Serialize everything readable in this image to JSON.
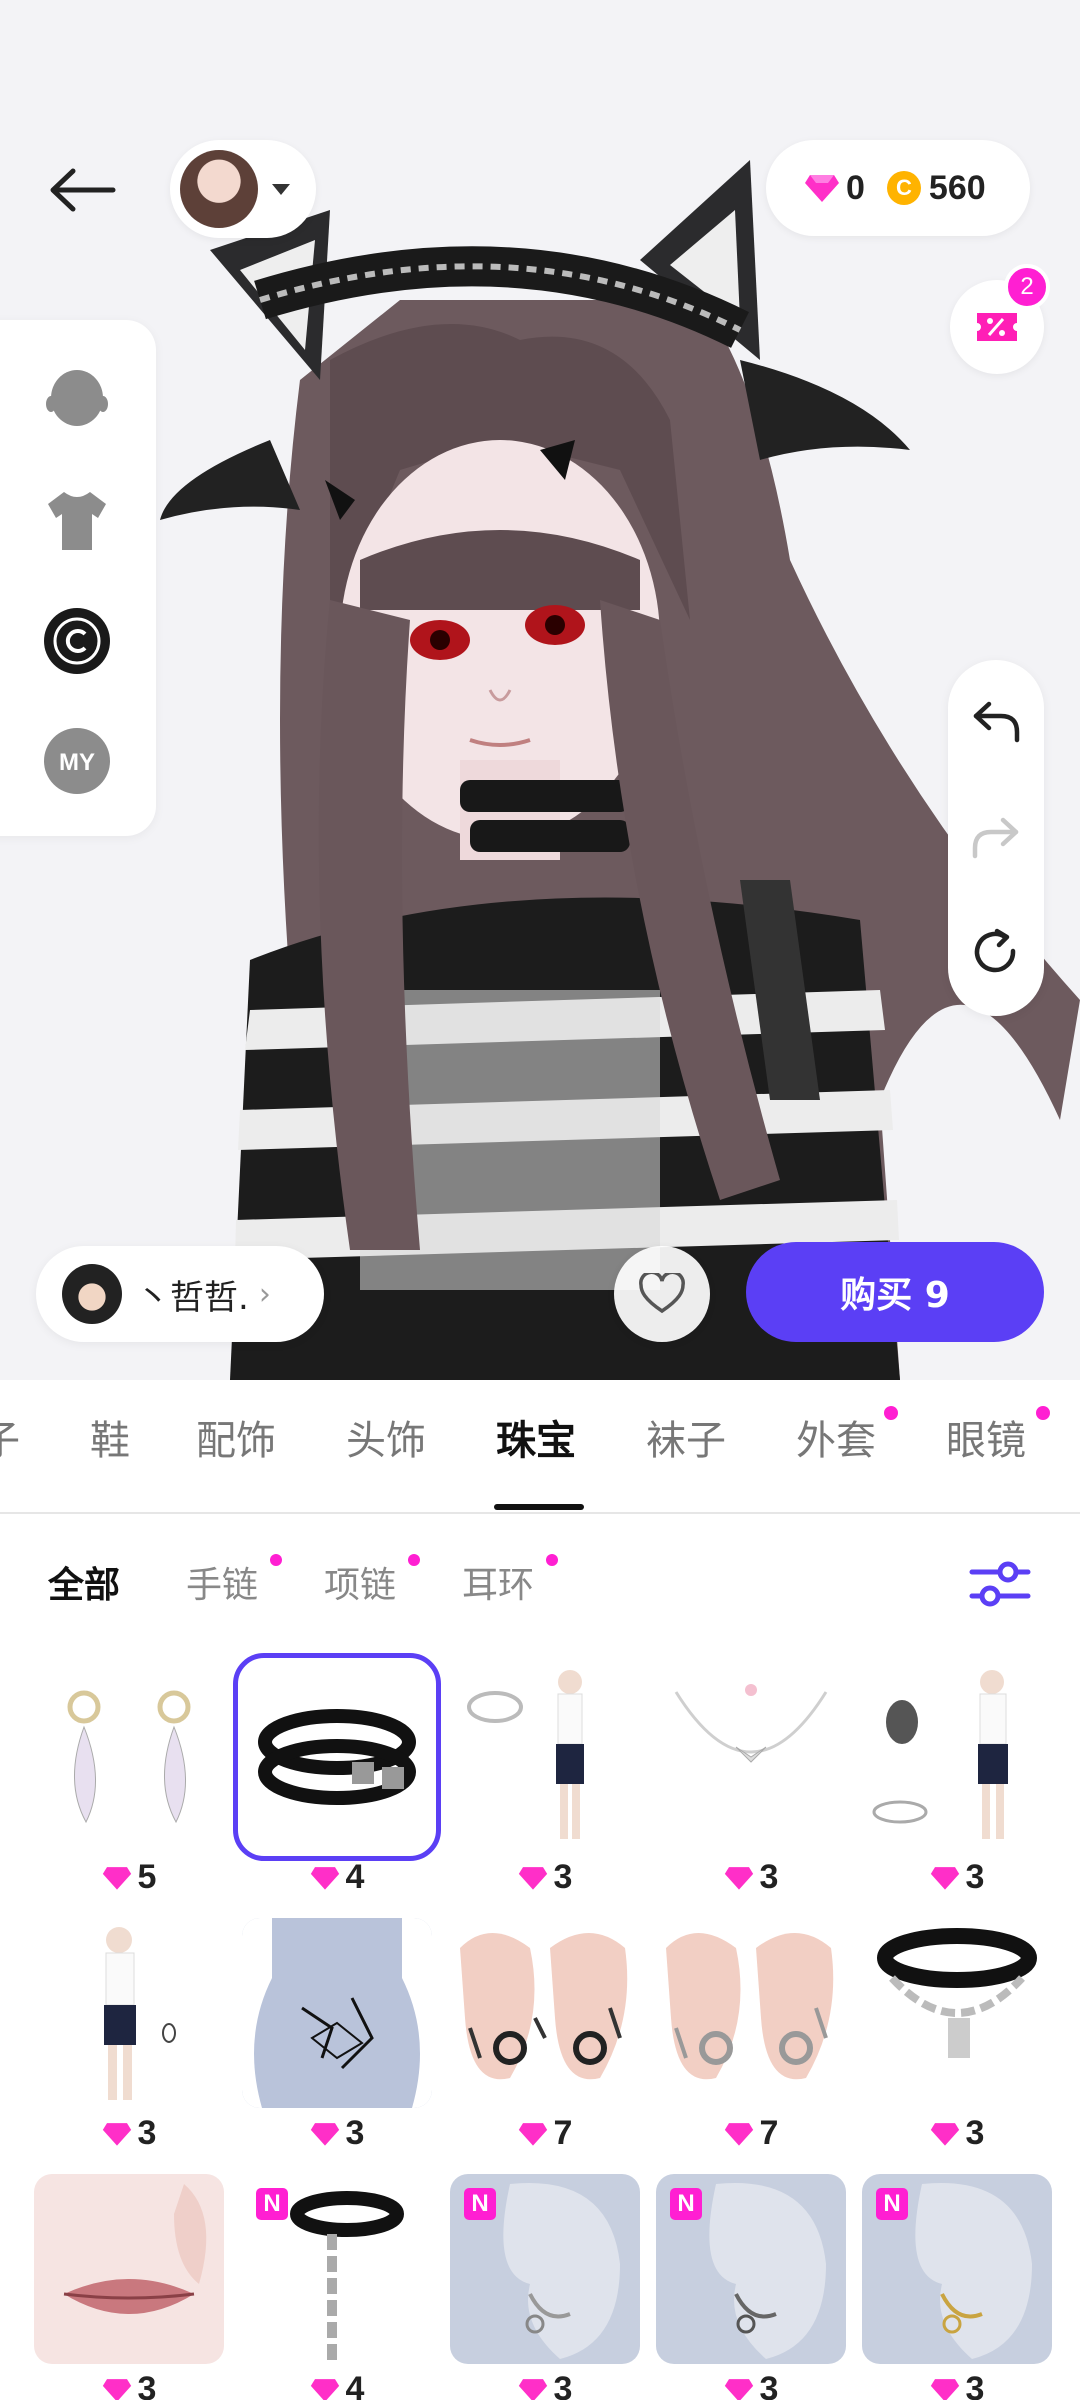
{
  "currency": {
    "gems": "0",
    "coin_symbol": "C",
    "coins": "560"
  },
  "coupon": {
    "badge_count": "2"
  },
  "creator": {
    "name": "丶哲哲.",
    "chevron": "›"
  },
  "buy": {
    "label": "购买 9"
  },
  "category_tabs": [
    {
      "label": "子",
      "active": false,
      "dot": false
    },
    {
      "label": "鞋",
      "active": false,
      "dot": false
    },
    {
      "label": "配饰",
      "active": false,
      "dot": false
    },
    {
      "label": "头饰",
      "active": false,
      "dot": false
    },
    {
      "label": "珠宝",
      "active": true,
      "dot": false
    },
    {
      "label": "袜子",
      "active": false,
      "dot": false
    },
    {
      "label": "外套",
      "active": false,
      "dot": true
    },
    {
      "label": "眼镜",
      "active": false,
      "dot": true
    }
  ],
  "sub_tabs": [
    {
      "label": "全部",
      "active": true,
      "dot": false
    },
    {
      "label": "手链",
      "active": false,
      "dot": true
    },
    {
      "label": "项链",
      "active": false,
      "dot": true
    },
    {
      "label": "耳环",
      "active": false,
      "dot": true
    }
  ],
  "items": [
    {
      "name": "pearl-earrings",
      "price": "5",
      "selected": false,
      "new": false
    },
    {
      "name": "black-choker",
      "price": "4",
      "selected": true,
      "new": false
    },
    {
      "name": "bangle",
      "price": "3",
      "selected": false,
      "new": false
    },
    {
      "name": "butterfly-necklace",
      "price": "3",
      "selected": false,
      "new": false
    },
    {
      "name": "bracelets",
      "price": "3",
      "selected": false,
      "new": false
    },
    {
      "name": "small-ring",
      "price": "3",
      "selected": false,
      "new": false
    },
    {
      "name": "neck-tattoo",
      "price": "3",
      "selected": false,
      "new": false
    },
    {
      "name": "ear-cuffs-a",
      "price": "7",
      "selected": false,
      "new": false
    },
    {
      "name": "ear-cuffs-b",
      "price": "7",
      "selected": false,
      "new": false
    },
    {
      "name": "chain-choker",
      "price": "3",
      "selected": false,
      "new": false
    },
    {
      "name": "lip-piercing",
      "price": "3",
      "selected": false,
      "new": false
    },
    {
      "name": "chain-collar",
      "price": "4",
      "selected": false,
      "new": true
    },
    {
      "name": "ear-rings-silver",
      "price": "3",
      "selected": false,
      "new": true
    },
    {
      "name": "ear-rings-mixed",
      "price": "3",
      "selected": false,
      "new": true
    },
    {
      "name": "ear-rings-gold",
      "price": "3",
      "selected": false,
      "new": true
    }
  ],
  "new_badge_label": "N",
  "side_menu": {
    "my_label": "MY"
  },
  "colors": {
    "accent": "#5b3ff5",
    "badge": "#ff1fd2",
    "gem": "#ff2fc8",
    "coin": "#ffb300"
  }
}
